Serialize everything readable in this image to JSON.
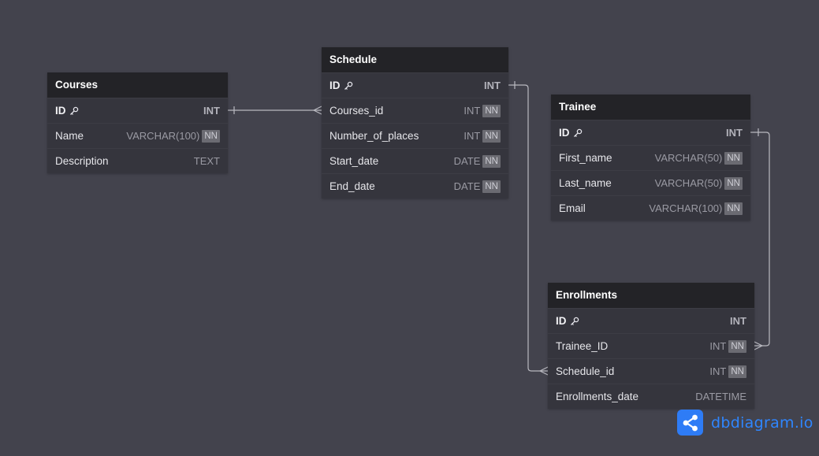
{
  "tables": [
    {
      "id": "courses",
      "name": "Courses",
      "columns": [
        {
          "name": "ID",
          "type": "INT",
          "pk": true,
          "nn": false
        },
        {
          "name": "Name",
          "type": "VARCHAR(100)",
          "pk": false,
          "nn": true
        },
        {
          "name": "Description",
          "type": "TEXT",
          "pk": false,
          "nn": false
        }
      ]
    },
    {
      "id": "schedule",
      "name": "Schedule",
      "columns": [
        {
          "name": "ID",
          "type": "INT",
          "pk": true,
          "nn": false
        },
        {
          "name": "Courses_id",
          "type": "INT",
          "pk": false,
          "nn": true
        },
        {
          "name": "Number_of_places",
          "type": "INT",
          "pk": false,
          "nn": true
        },
        {
          "name": "Start_date",
          "type": "DATE",
          "pk": false,
          "nn": true
        },
        {
          "name": "End_date",
          "type": "DATE",
          "pk": false,
          "nn": true
        }
      ]
    },
    {
      "id": "trainee",
      "name": "Trainee",
      "columns": [
        {
          "name": "ID",
          "type": "INT",
          "pk": true,
          "nn": false
        },
        {
          "name": "First_name",
          "type": "VARCHAR(50)",
          "pk": false,
          "nn": true
        },
        {
          "name": "Last_name",
          "type": "VARCHAR(50)",
          "pk": false,
          "nn": true
        },
        {
          "name": "Email",
          "type": "VARCHAR(100)",
          "pk": false,
          "nn": true
        }
      ]
    },
    {
      "id": "enrollments",
      "name": "Enrollments",
      "columns": [
        {
          "name": "ID",
          "type": "INT",
          "pk": true,
          "nn": false
        },
        {
          "name": "Trainee_ID",
          "type": "INT",
          "pk": false,
          "nn": true
        },
        {
          "name": "Schedule_id",
          "type": "INT",
          "pk": false,
          "nn": true
        },
        {
          "name": "Enrollments_date",
          "type": "DATETIME",
          "pk": false,
          "nn": false
        }
      ]
    }
  ],
  "relations": [
    {
      "from": "courses.ID",
      "to": "schedule.Courses_id",
      "type": "one-to-many"
    },
    {
      "from": "schedule.ID",
      "to": "enrollments.Schedule_id",
      "type": "one-to-many"
    },
    {
      "from": "trainee.ID",
      "to": "enrollments.Trainee_ID",
      "type": "one-to-many"
    }
  ],
  "nn_label": "NN",
  "brand": {
    "text": "dbdiagram.io"
  },
  "colors": {
    "canvas": "#43434d",
    "table_header": "#232327",
    "table_body": "#35353d",
    "connector": "#b9b9c0",
    "brand": "#2e7cf6"
  },
  "icons": {
    "primary_key": "key-icon",
    "brand_logo": "share-nodes-icon"
  }
}
